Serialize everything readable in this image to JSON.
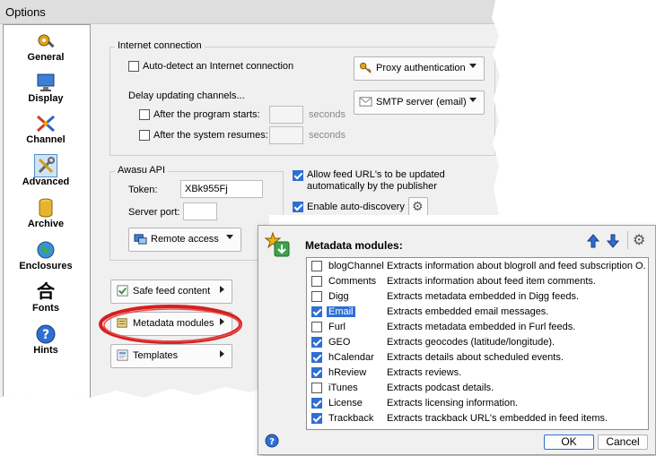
{
  "window": {
    "title": "Options"
  },
  "sidebar": {
    "items": [
      {
        "label": "General",
        "icon": "gear-tools-icon"
      },
      {
        "label": "Display",
        "icon": "monitor-icon"
      },
      {
        "label": "Channel",
        "icon": "channel-arrows-icon"
      },
      {
        "label": "Advanced",
        "icon": "wrench-screwdriver-icon",
        "selected": true
      },
      {
        "label": "Archive",
        "icon": "database-icon"
      },
      {
        "label": "Enclosures",
        "icon": "globe-icon"
      },
      {
        "label": "Fonts",
        "icon": "chinese-character-icon"
      },
      {
        "label": "Hints",
        "icon": "help-icon"
      }
    ]
  },
  "internet": {
    "group_label": "Internet connection",
    "auto_detect": "Auto-detect an Internet connection",
    "proxy_button": "Proxy authentication",
    "smtp_button": "SMTP server (email)",
    "delay_label": "Delay updating channels...",
    "after_start": "After the program starts:",
    "after_resume": "After the system resumes:",
    "seconds1": "seconds",
    "seconds2": "seconds"
  },
  "api": {
    "group_label": "Awasu API",
    "token_label": "Token:",
    "token_value": "XBk955Fj",
    "port_label": "Server port:",
    "port_value": "",
    "remote_button": "Remote access"
  },
  "feeds": {
    "allow_update": "Allow feed URL's to be updated automatically by the publisher",
    "auto_discovery": "Enable auto-discovery"
  },
  "actions": {
    "safe_feed": "Safe feed content",
    "metadata": "Metadata modules",
    "templates": "Templates"
  },
  "popup": {
    "title": "Metadata modules:",
    "modules": [
      {
        "name": "blogChannel",
        "desc": "Extracts information about blogroll and feed subscription O...",
        "checked": false
      },
      {
        "name": "Comments",
        "desc": "Extracts information about feed item comments.",
        "checked": false
      },
      {
        "name": "Digg",
        "desc": "Extracts metadata embedded in Digg feeds.",
        "checked": false
      },
      {
        "name": "Email",
        "desc": "Extracts embedded email messages.",
        "checked": true,
        "highlighted": true
      },
      {
        "name": "Furl",
        "desc": "Extracts metadata embedded in Furl feeds.",
        "checked": false
      },
      {
        "name": "GEO",
        "desc": "Extracts geocodes (latitude/longitude).",
        "checked": true
      },
      {
        "name": "hCalendar",
        "desc": "Extracts details about scheduled events.",
        "checked": true
      },
      {
        "name": "hReview",
        "desc": "Extracts reviews.",
        "checked": true
      },
      {
        "name": "iTunes",
        "desc": "Extracts podcast details.",
        "checked": false
      },
      {
        "name": "License",
        "desc": "Extracts licensing information.",
        "checked": true
      },
      {
        "name": "Trackback",
        "desc": "Extracts trackback URL's embedded in feed items.",
        "checked": true
      }
    ],
    "ok": "OK",
    "cancel": "Cancel"
  },
  "colors": {
    "accent": "#2f6fd3",
    "highlight_ring": "#d42020"
  }
}
